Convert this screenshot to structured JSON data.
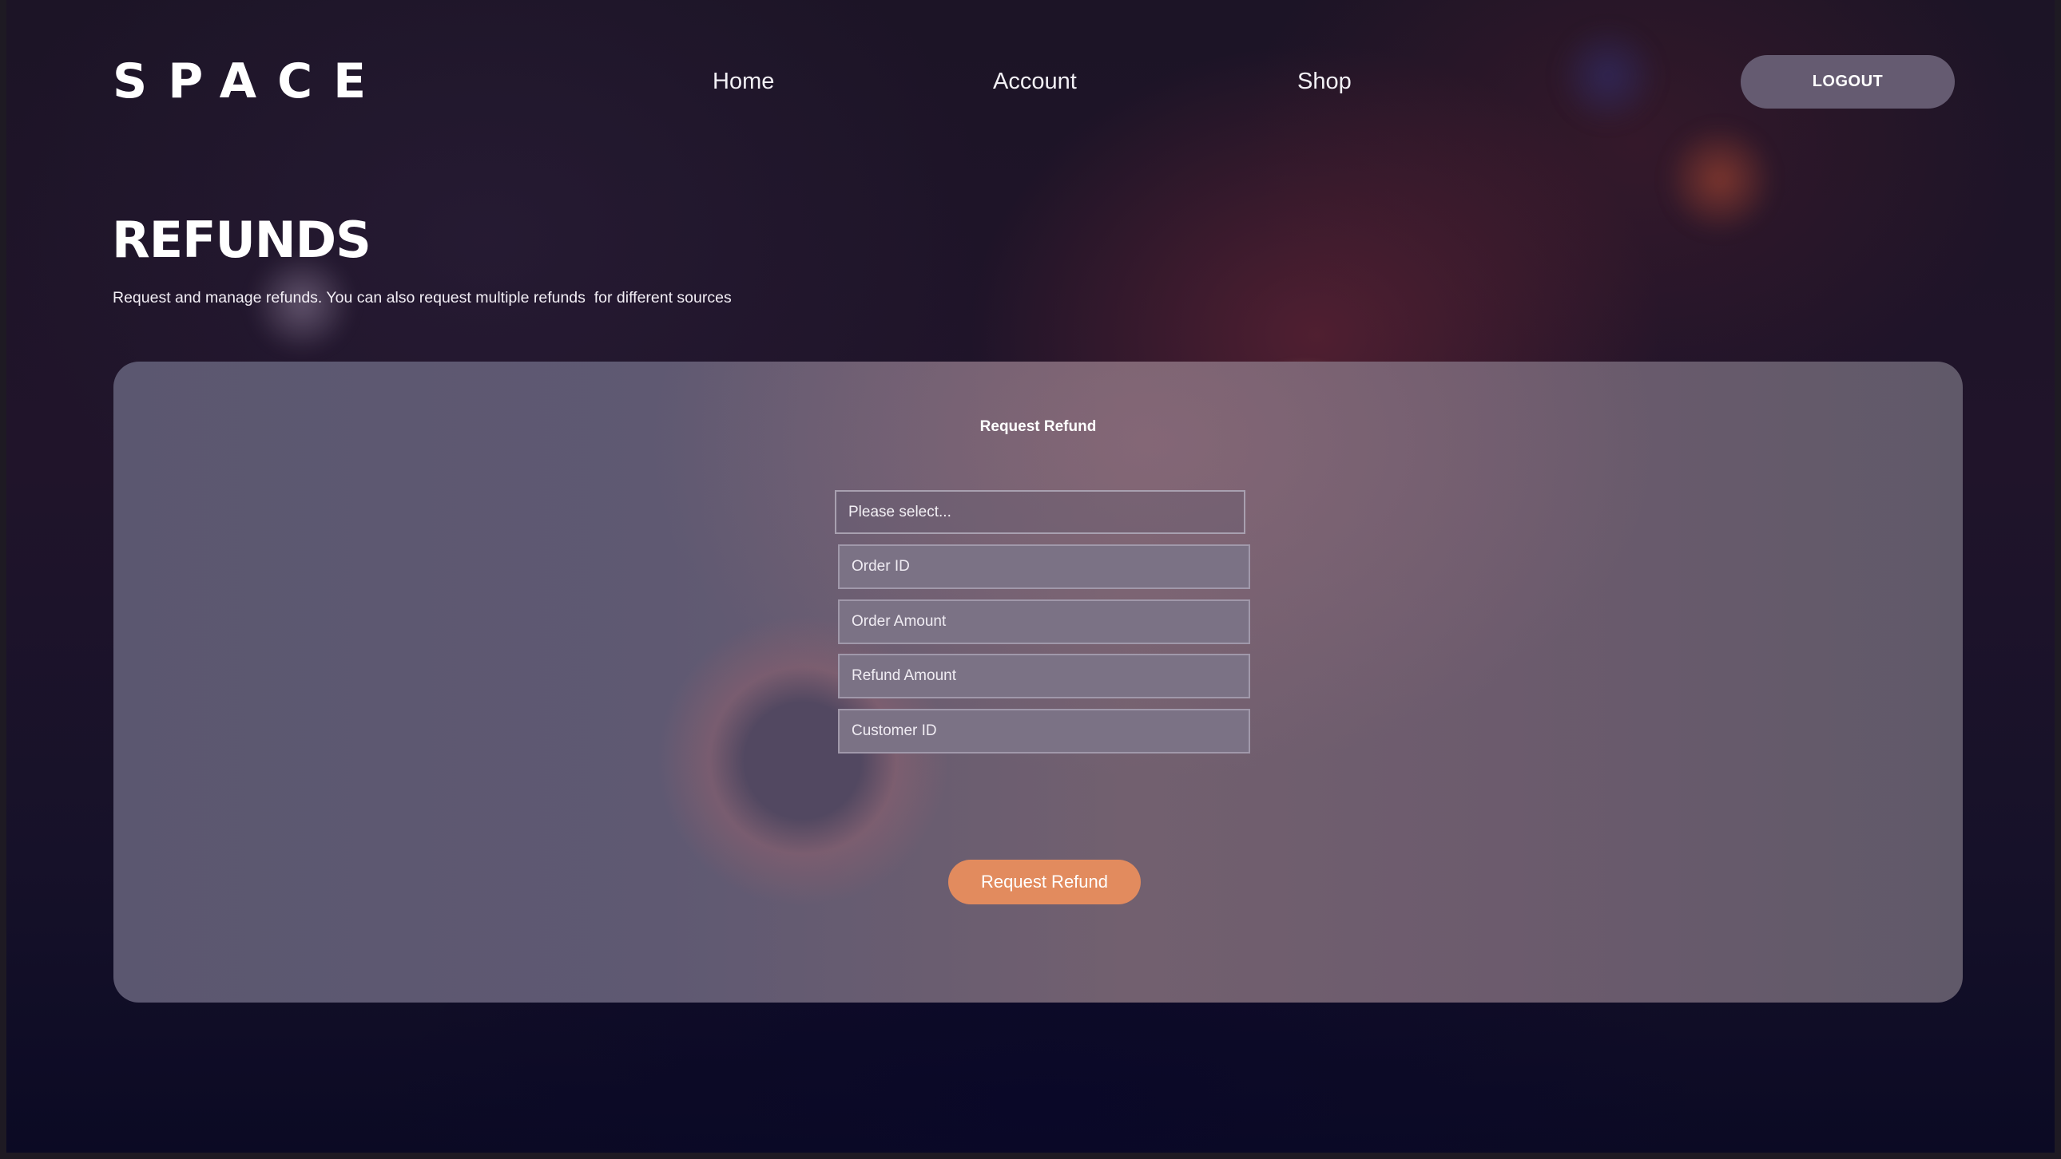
{
  "header": {
    "logo": "SPACE",
    "nav": [
      {
        "label": "Home"
      },
      {
        "label": "Account"
      },
      {
        "label": "Shop"
      }
    ],
    "logout_label": "LOGOUT"
  },
  "page": {
    "title": "REFUNDS",
    "subtitle": "Request and manage refunds. You can also request multiple refunds  for different sources"
  },
  "refund_form": {
    "title": "Request Refund",
    "source_select": {
      "selected": "Please select..."
    },
    "fields": [
      {
        "placeholder": "Order ID",
        "value": ""
      },
      {
        "placeholder": "Order Amount",
        "value": ""
      },
      {
        "placeholder": "Refund Amount",
        "value": ""
      },
      {
        "placeholder": "Customer ID",
        "value": ""
      }
    ],
    "submit_label": "Request Refund"
  },
  "colors": {
    "accent": "#e28b5e",
    "logout_button": "#655b71",
    "card": "#5f5972"
  }
}
